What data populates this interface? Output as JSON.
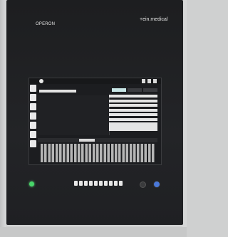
{
  "device": {
    "brand_left": "OPERON",
    "brand_right_mark": "+",
    "brand_right_text": "+ein.medical"
  },
  "screen": {
    "header_text": "",
    "tabs": [
      "",
      "",
      ""
    ],
    "active_tab_index": 0,
    "form_labels": [
      "",
      "",
      "",
      "",
      "",
      "",
      "",
      ""
    ],
    "mid_button_label": ""
  },
  "colors": {
    "panel": "#1f2023",
    "status_led": "#48d66a",
    "blue_button": "#4a78d8",
    "active_tab": "#c8e6e6"
  },
  "icons": {
    "power_led": "green-led-icon",
    "blue_button": "blue-round-button"
  }
}
